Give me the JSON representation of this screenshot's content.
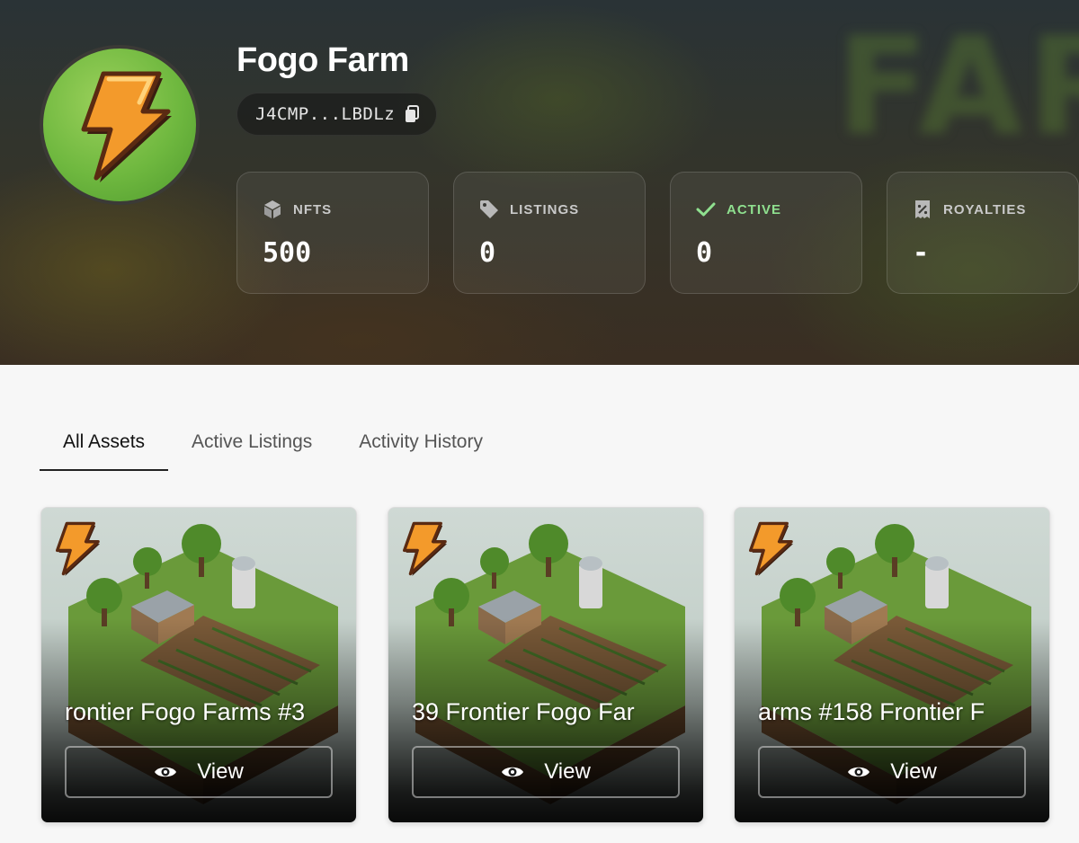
{
  "collection": {
    "title": "Fogo Farm",
    "address": "J4CMP...LBDLz",
    "background_word": "FAR"
  },
  "stats": [
    {
      "label": "NFTS",
      "value": "500",
      "icon": "cube-icon"
    },
    {
      "label": "LISTINGS",
      "value": "0",
      "icon": "tag-icon"
    },
    {
      "label": "ACTIVE",
      "value": "0",
      "icon": "check-icon"
    },
    {
      "label": "ROYALTIES",
      "value": "-",
      "icon": "percent-badge-icon"
    }
  ],
  "tabs": [
    {
      "label": "All Assets",
      "active": true
    },
    {
      "label": "Active Listings",
      "active": false
    },
    {
      "label": "Activity History",
      "active": false
    }
  ],
  "cards": [
    {
      "name_visible": "rontier Fogo Farms #3",
      "button": "View"
    },
    {
      "name_visible": "39   Frontier Fogo Far",
      "button": "View"
    },
    {
      "name_visible": "arms #158   Frontier F",
      "button": "View"
    }
  ],
  "colors": {
    "accent_green": "#8fe08f",
    "logo_orange": "#f39a2b",
    "logo_bg_green": "#6fb83f"
  }
}
